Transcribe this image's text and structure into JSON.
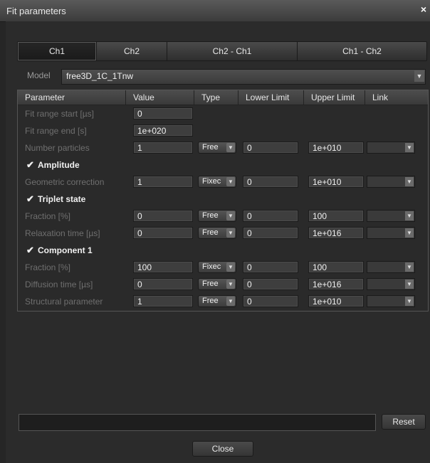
{
  "window": {
    "title": "Fit parameters",
    "close_glyph": "×"
  },
  "tabs": [
    "Ch1",
    "Ch2",
    "Ch2 - Ch1",
    "Ch1 - Ch2"
  ],
  "model": {
    "label": "Model",
    "value": "free3D_1C_1Tnw",
    "arrow": "▼"
  },
  "table": {
    "headers": [
      "Parameter",
      "Value",
      "Type",
      "Lower Limit",
      "Upper Limit",
      "Link"
    ],
    "rows": [
      {
        "kind": "param",
        "name": "Fit range start [µs]",
        "value": "0"
      },
      {
        "kind": "param",
        "name": "Fit range end [s]",
        "value": "1e+020"
      },
      {
        "kind": "param",
        "name": "Number particles",
        "value": "1",
        "type": "Free",
        "lower": "0",
        "upper": "1e+010"
      },
      {
        "kind": "section",
        "name": "Amplitude",
        "checked": true
      },
      {
        "kind": "param",
        "name": "Geometric correction",
        "value": "1",
        "type": "Fixec",
        "lower": "0",
        "upper": "1e+010"
      },
      {
        "kind": "section",
        "name": "Triplet state",
        "checked": true
      },
      {
        "kind": "param",
        "name": "Fraction [%]",
        "value": "0",
        "type": "Free",
        "lower": "0",
        "upper": "100"
      },
      {
        "kind": "param",
        "name": "Relaxation time [µs]",
        "value": "0",
        "type": "Free",
        "lower": "0",
        "upper": "1e+016"
      },
      {
        "kind": "section",
        "name": "Component 1",
        "checked": true
      },
      {
        "kind": "param",
        "name": "Fraction [%]",
        "value": "100",
        "type": "Fixec",
        "lower": "0",
        "upper": "100"
      },
      {
        "kind": "param",
        "name": "Diffusion time [µs]",
        "value": "0",
        "type": "Free",
        "lower": "0",
        "upper": "1e+016"
      },
      {
        "kind": "param",
        "name": "Structural parameter",
        "value": "1",
        "type": "Free",
        "lower": "0",
        "upper": "1e+010"
      }
    ]
  },
  "buttons": {
    "reset": "Reset",
    "close": "Close"
  },
  "status": {
    "text": ""
  }
}
